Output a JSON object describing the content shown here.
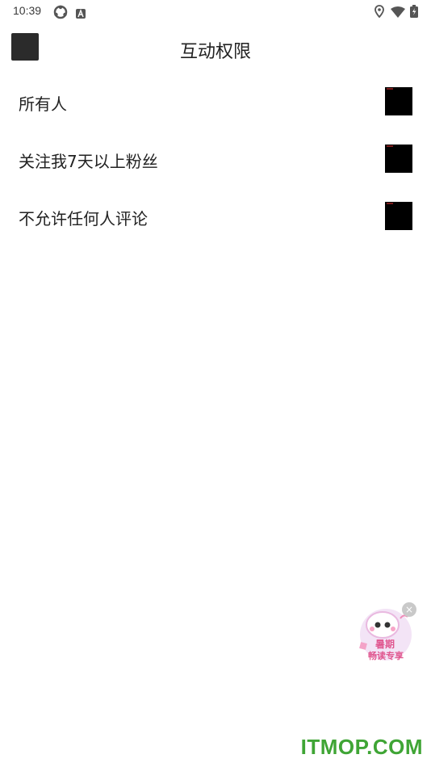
{
  "status_bar": {
    "time": "10:39",
    "icons": [
      "sync-icon",
      "a-badge-icon",
      "location-icon",
      "wifi-icon",
      "battery-icon"
    ]
  },
  "header": {
    "title": "互动权限"
  },
  "options": [
    {
      "label": "所有人"
    },
    {
      "label": "关注我7天以上粉丝"
    },
    {
      "label": "不允许任何人评论"
    }
  ],
  "promo": {
    "text_line1": "暑期",
    "text_line2": "畅读专享",
    "close": "×"
  },
  "watermark": "ITMOP.COM",
  "colors": {
    "accent": "#3fa535",
    "box": "#000000",
    "back_button": "#2b2b2b"
  }
}
